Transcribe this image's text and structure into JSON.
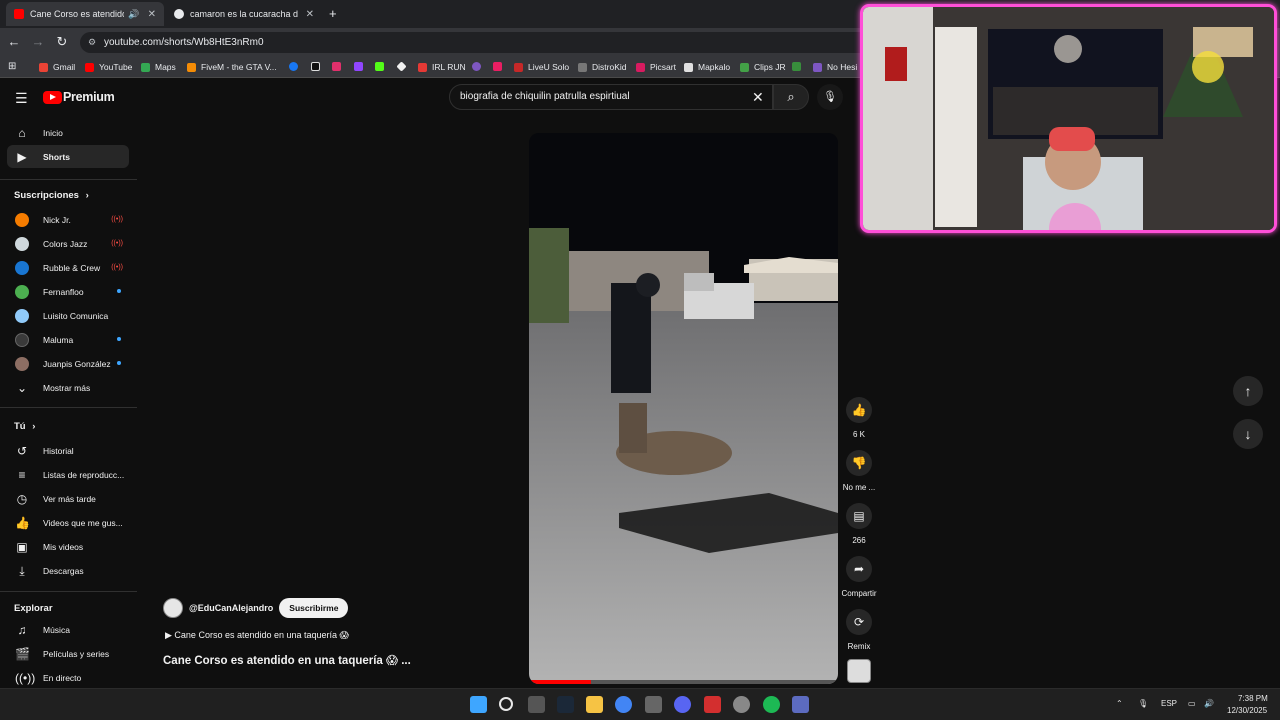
{
  "browser": {
    "tabs": [
      {
        "title": "Cane Corso es atendido en una taquería",
        "active": true
      },
      {
        "title": "camaron es la cucaracha del mar",
        "active": false
      }
    ],
    "url": "youtube.com/shorts/Wb8HtE3nRm0",
    "bookmarks": [
      {
        "label": "Gmail",
        "color": "#ea4335"
      },
      {
        "label": "YouTube",
        "color": "#ff0000"
      },
      {
        "label": "Maps",
        "color": "#34a853"
      },
      {
        "label": "FiveM - the GTA V...",
        "color": "#f48c06"
      },
      {
        "label": "IRL RUN",
        "color": "#e53935"
      },
      {
        "label": "LiveU Solo",
        "color": "#c62828"
      },
      {
        "label": "DistroKid",
        "color": "#555555"
      },
      {
        "label": "Picsart",
        "color": "#d81b60"
      },
      {
        "label": "Mapkalo",
        "color": "#e0e0e0"
      },
      {
        "label": "Clips JR",
        "color": "#43a047"
      },
      {
        "label": "No Hesi",
        "color": "#7e57c2"
      }
    ]
  },
  "youtube": {
    "brand": "Premium",
    "search_query": "biografia de chiquilin patrulla espirtiual",
    "sidebar": {
      "main": [
        {
          "label": "Inicio",
          "icon": "home-icon"
        },
        {
          "label": "Shorts",
          "icon": "shorts-icon",
          "active": true
        }
      ],
      "subscriptions_header": "Suscripciones",
      "subscriptions": [
        {
          "label": "Nick Jr.",
          "color": "#f57c00",
          "badge": "live"
        },
        {
          "label": "Colors Jazz",
          "color": "#cfd8dc",
          "badge": "live"
        },
        {
          "label": "Rubble & Crew",
          "color": "#1976d2",
          "badge": "live"
        },
        {
          "label": "Fernanfloo",
          "color": "#4caf50",
          "badge": "dot"
        },
        {
          "label": "Luisito Comunica",
          "color": "#90caf9",
          "badge": ""
        },
        {
          "label": "Maluma",
          "color": "#3a3a3a",
          "badge": "dot"
        },
        {
          "label": "Juanpis González",
          "color": "#8d6e63",
          "badge": "dot"
        }
      ],
      "show_more": "Mostrar más",
      "you_header": "Tú",
      "you": [
        {
          "label": "Historial",
          "icon": "history-icon"
        },
        {
          "label": "Listas de reproducc...",
          "icon": "playlists-icon"
        },
        {
          "label": "Ver más tarde",
          "icon": "watch-later-icon"
        },
        {
          "label": "Videos que me gus...",
          "icon": "liked-icon"
        },
        {
          "label": "Mis videos",
          "icon": "my-videos-icon"
        },
        {
          "label": "Descargas",
          "icon": "downloads-icon"
        }
      ],
      "explore_header": "Explorar",
      "explore": [
        {
          "label": "Música",
          "icon": "music-icon"
        },
        {
          "label": "Películas y series",
          "icon": "movies-icon"
        },
        {
          "label": "En directo",
          "icon": "live-icon"
        }
      ]
    },
    "short": {
      "channel": "@EduCanAlejandro",
      "subscribe": "Suscribirme",
      "description": "▶ Cane Corso es atendido en una taquería 😱",
      "title": "Cane Corso es atendido en una taquería 😱 ...",
      "progress": 0.2,
      "actions": {
        "likes": "6 K",
        "dislike": "No me ...",
        "comments": "266",
        "share": "Compartir",
        "remix": "Remix"
      }
    }
  },
  "taskbar": {
    "language": "ESP",
    "time": "7:38 PM",
    "date": "12/30/2025"
  }
}
